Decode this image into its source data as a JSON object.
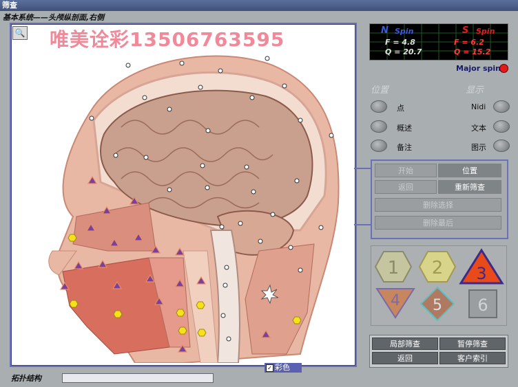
{
  "window": {
    "title": "筛查",
    "subtitle": "基本系统——头颅纵剖面,右侧"
  },
  "watermark": "唯美诠彩13506763595",
  "spin": {
    "n_label": "N",
    "s_label": "S",
    "spin_word": "Spin",
    "n_f": "F = 4.8",
    "n_q": "Q = 20.7",
    "s_f": "F = 6.2",
    "s_q": "Q = 15.2"
  },
  "major_spin": "Major spin",
  "left_section": {
    "title": "位置",
    "items": [
      "点",
      "概述",
      "备注"
    ]
  },
  "right_section": {
    "title": "显示",
    "items": [
      "Nidi",
      "文本",
      "图示"
    ]
  },
  "buttons": {
    "start": "开始",
    "position": "位置",
    "back": "返回",
    "rescreen": "重新筛查",
    "delete_selected": "删除选择",
    "delete_last": "删除最后"
  },
  "shapes": [
    "1",
    "2",
    "3",
    "4",
    "5",
    "6"
  ],
  "bottom_buttons": {
    "local": "局部筛查",
    "pause": "暂停筛查",
    "return": "返回",
    "client": "客户索引"
  },
  "color_toggle": {
    "label": "彩色",
    "checked": true
  },
  "status_label": "拓扑结构",
  "colors": {
    "accent": "#6a6fb8",
    "major_dot": "#e01b1b"
  }
}
